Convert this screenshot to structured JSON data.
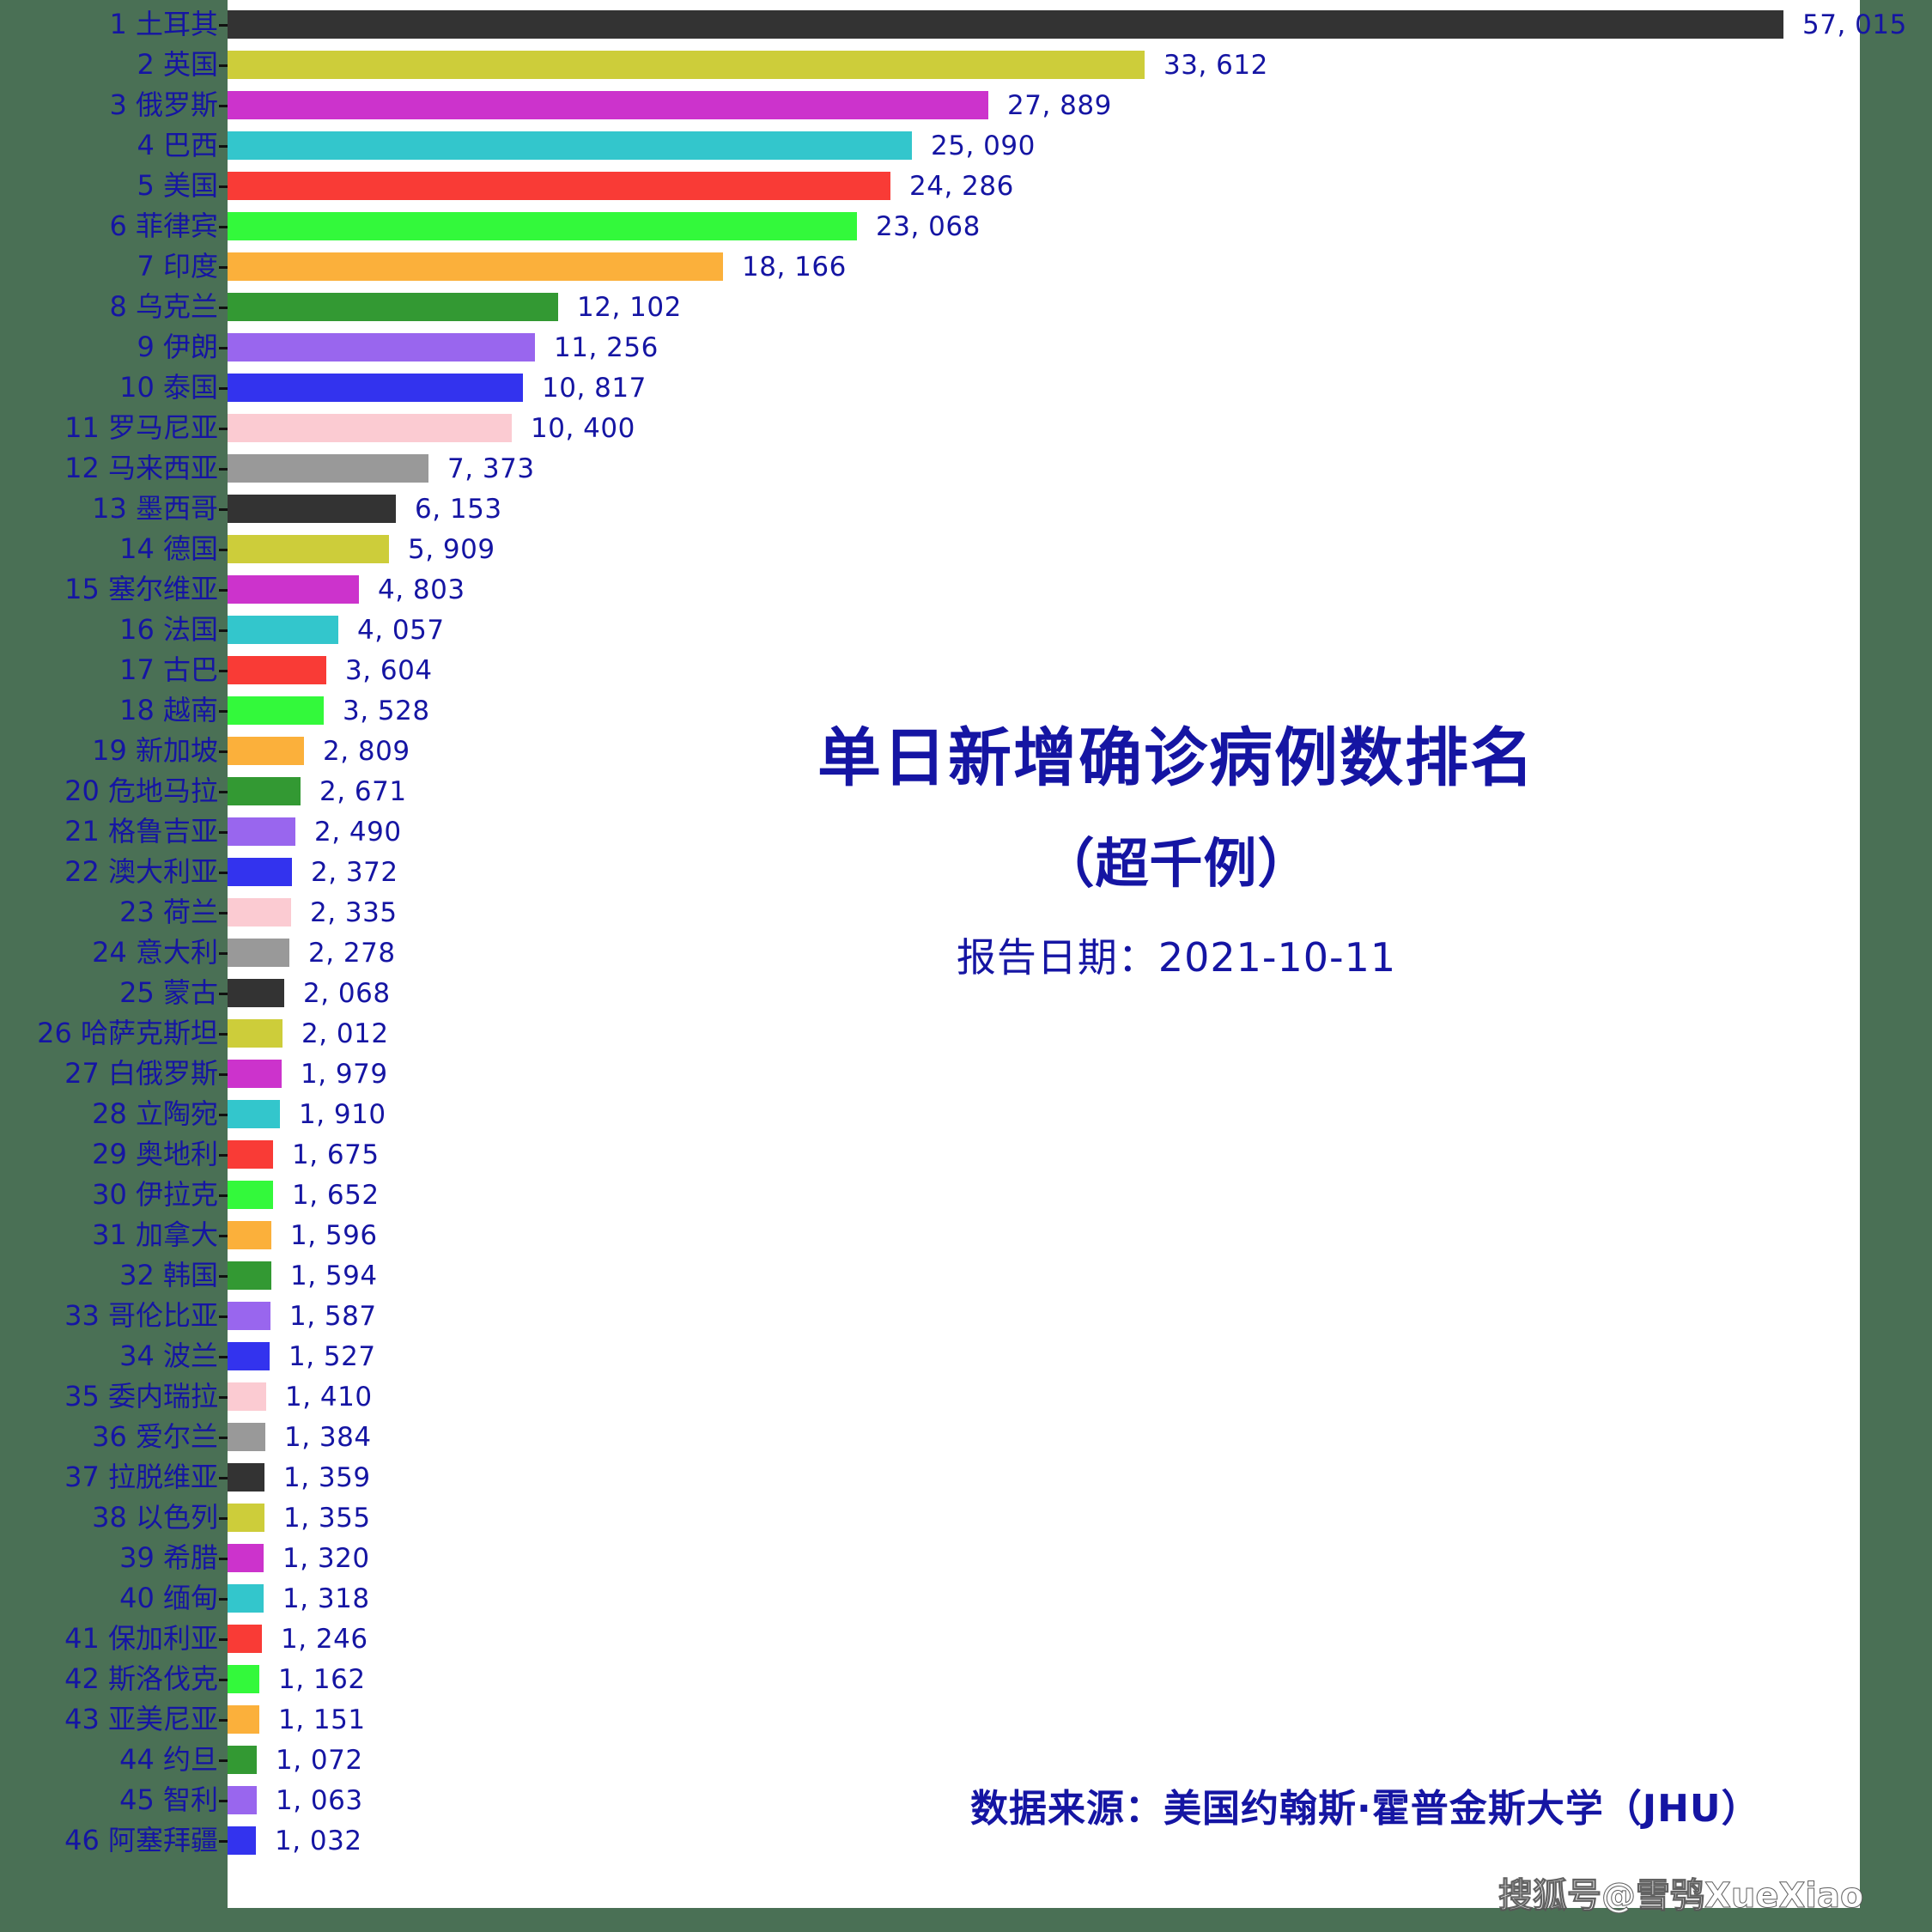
{
  "chart_data": {
    "type": "bar",
    "orientation": "horizontal",
    "title": "单日新增确诊病例数排名",
    "subtitle": "（超千例）",
    "report_date_label": "报告日期：2021-10-11",
    "source_note": "数据来源：美国约翰斯·霍普金斯大学（JHU）",
    "watermark": "搜狐号@雪鸮XueXiao",
    "xlabel": "",
    "ylabel": "",
    "xlim": [
      0,
      57015
    ],
    "grid": false,
    "legend": "none",
    "accent_color": "#1515a3",
    "background_color": "#4a7055",
    "plot_background_color": "#ffffff",
    "palette": [
      "#333333",
      "#cdcd3a",
      "#cc33cc",
      "#33c6cc",
      "#f93b36",
      "#33f93b",
      "#fbb03b",
      "#339933",
      "#9966ee",
      "#3333ee",
      "#fbcbd2",
      "#999999"
    ],
    "categories": [
      "土耳其",
      "英国",
      "俄罗斯",
      "巴西",
      "美国",
      "菲律宾",
      "印度",
      "乌克兰",
      "伊朗",
      "泰国",
      "罗马尼亚",
      "马来西亚",
      "墨西哥",
      "德国",
      "塞尔维亚",
      "法国",
      "古巴",
      "越南",
      "新加坡",
      "危地马拉",
      "格鲁吉亚",
      "澳大利亚",
      "荷兰",
      "意大利",
      "蒙古",
      "哈萨克斯坦",
      "白俄罗斯",
      "立陶宛",
      "奥地利",
      "伊拉克",
      "加拿大",
      "韩国",
      "哥伦比亚",
      "波兰",
      "委内瑞拉",
      "爱尔兰",
      "拉脱维亚",
      "以色列",
      "希腊",
      "缅甸",
      "保加利亚",
      "斯洛伐克",
      "亚美尼亚",
      "约旦",
      "智利",
      "阿塞拜疆"
    ],
    "values": [
      57015,
      33612,
      27889,
      25090,
      24286,
      23068,
      18166,
      12102,
      11256,
      10817,
      10400,
      7373,
      6153,
      5909,
      4803,
      4057,
      3604,
      3528,
      2809,
      2671,
      2490,
      2372,
      2335,
      2278,
      2068,
      2012,
      1979,
      1910,
      1675,
      1652,
      1596,
      1594,
      1587,
      1527,
      1410,
      1384,
      1359,
      1355,
      1320,
      1318,
      1246,
      1162,
      1151,
      1072,
      1063,
      1032
    ],
    "value_labels": [
      "57, 015",
      "33, 612",
      "27, 889",
      "25, 090",
      "24, 286",
      "23, 068",
      "18, 166",
      "12, 102",
      "11, 256",
      "10, 817",
      "10, 400",
      "7, 373",
      "6, 153",
      "5, 909",
      "4, 803",
      "4, 057",
      "3, 604",
      "3, 528",
      "2, 809",
      "2, 671",
      "2, 490",
      "2, 372",
      "2, 335",
      "2, 278",
      "2, 068",
      "2, 012",
      "1, 979",
      "1, 910",
      "1, 675",
      "1, 652",
      "1, 596",
      "1, 594",
      "1, 587",
      "1, 527",
      "1, 410",
      "1, 384",
      "1, 359",
      "1, 355",
      "1, 320",
      "1, 318",
      "1, 246",
      "1, 162",
      "1, 151",
      "1, 072",
      "1, 063",
      "1, 032"
    ],
    "rank_labels": [
      "1",
      "2",
      "3",
      "4",
      "5",
      "6",
      "7",
      "8",
      "9",
      "10",
      "11",
      "12",
      "13",
      "14",
      "15",
      "16",
      "17",
      "18",
      "19",
      "20",
      "21",
      "22",
      "23",
      "24",
      "25",
      "26",
      "27",
      "28",
      "29",
      "30",
      "31",
      "32",
      "33",
      "34",
      "35",
      "36",
      "37",
      "38",
      "39",
      "40",
      "41",
      "42",
      "43",
      "44",
      "45",
      "46"
    ]
  }
}
